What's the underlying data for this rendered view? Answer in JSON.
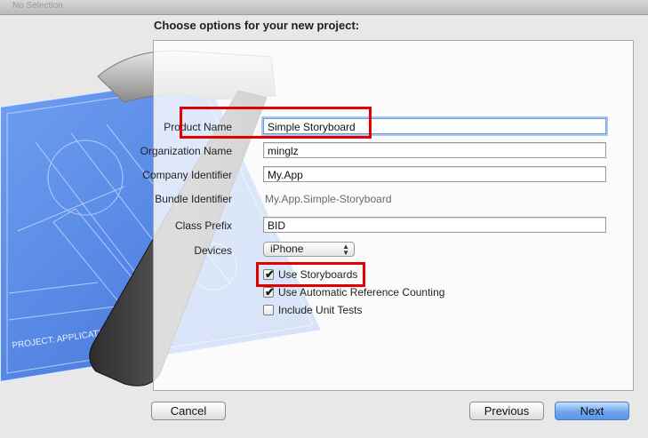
{
  "window": {
    "title": "No Selection"
  },
  "heading": "Choose options for your new project:",
  "blueprint": {
    "label": "PROJECT: APPLICATION.APP"
  },
  "form": {
    "product_name": {
      "label": "Product Name",
      "value": "Simple Storyboard"
    },
    "organization_name": {
      "label": "Organization Name",
      "value": "minglz"
    },
    "company_identifier": {
      "label": "Company Identifier",
      "value": "My.App"
    },
    "bundle_identifier": {
      "label": "Bundle Identifier",
      "value": "My.App.Simple-Storyboard"
    },
    "class_prefix": {
      "label": "Class Prefix",
      "value": "BID"
    },
    "devices": {
      "label": "Devices",
      "value": "iPhone"
    },
    "use_storyboards": {
      "label": "Use Storyboards",
      "checked": true
    },
    "use_arc": {
      "label": "Use Automatic Reference Counting",
      "checked": true
    },
    "include_unit_tests": {
      "label": "Include Unit Tests",
      "checked": false
    }
  },
  "buttons": {
    "cancel": "Cancel",
    "previous": "Previous",
    "next": "Next"
  },
  "colors": {
    "highlight": "#e00000",
    "primary_button": "#5a97e8",
    "focus_ring": "#6c9bd8"
  }
}
